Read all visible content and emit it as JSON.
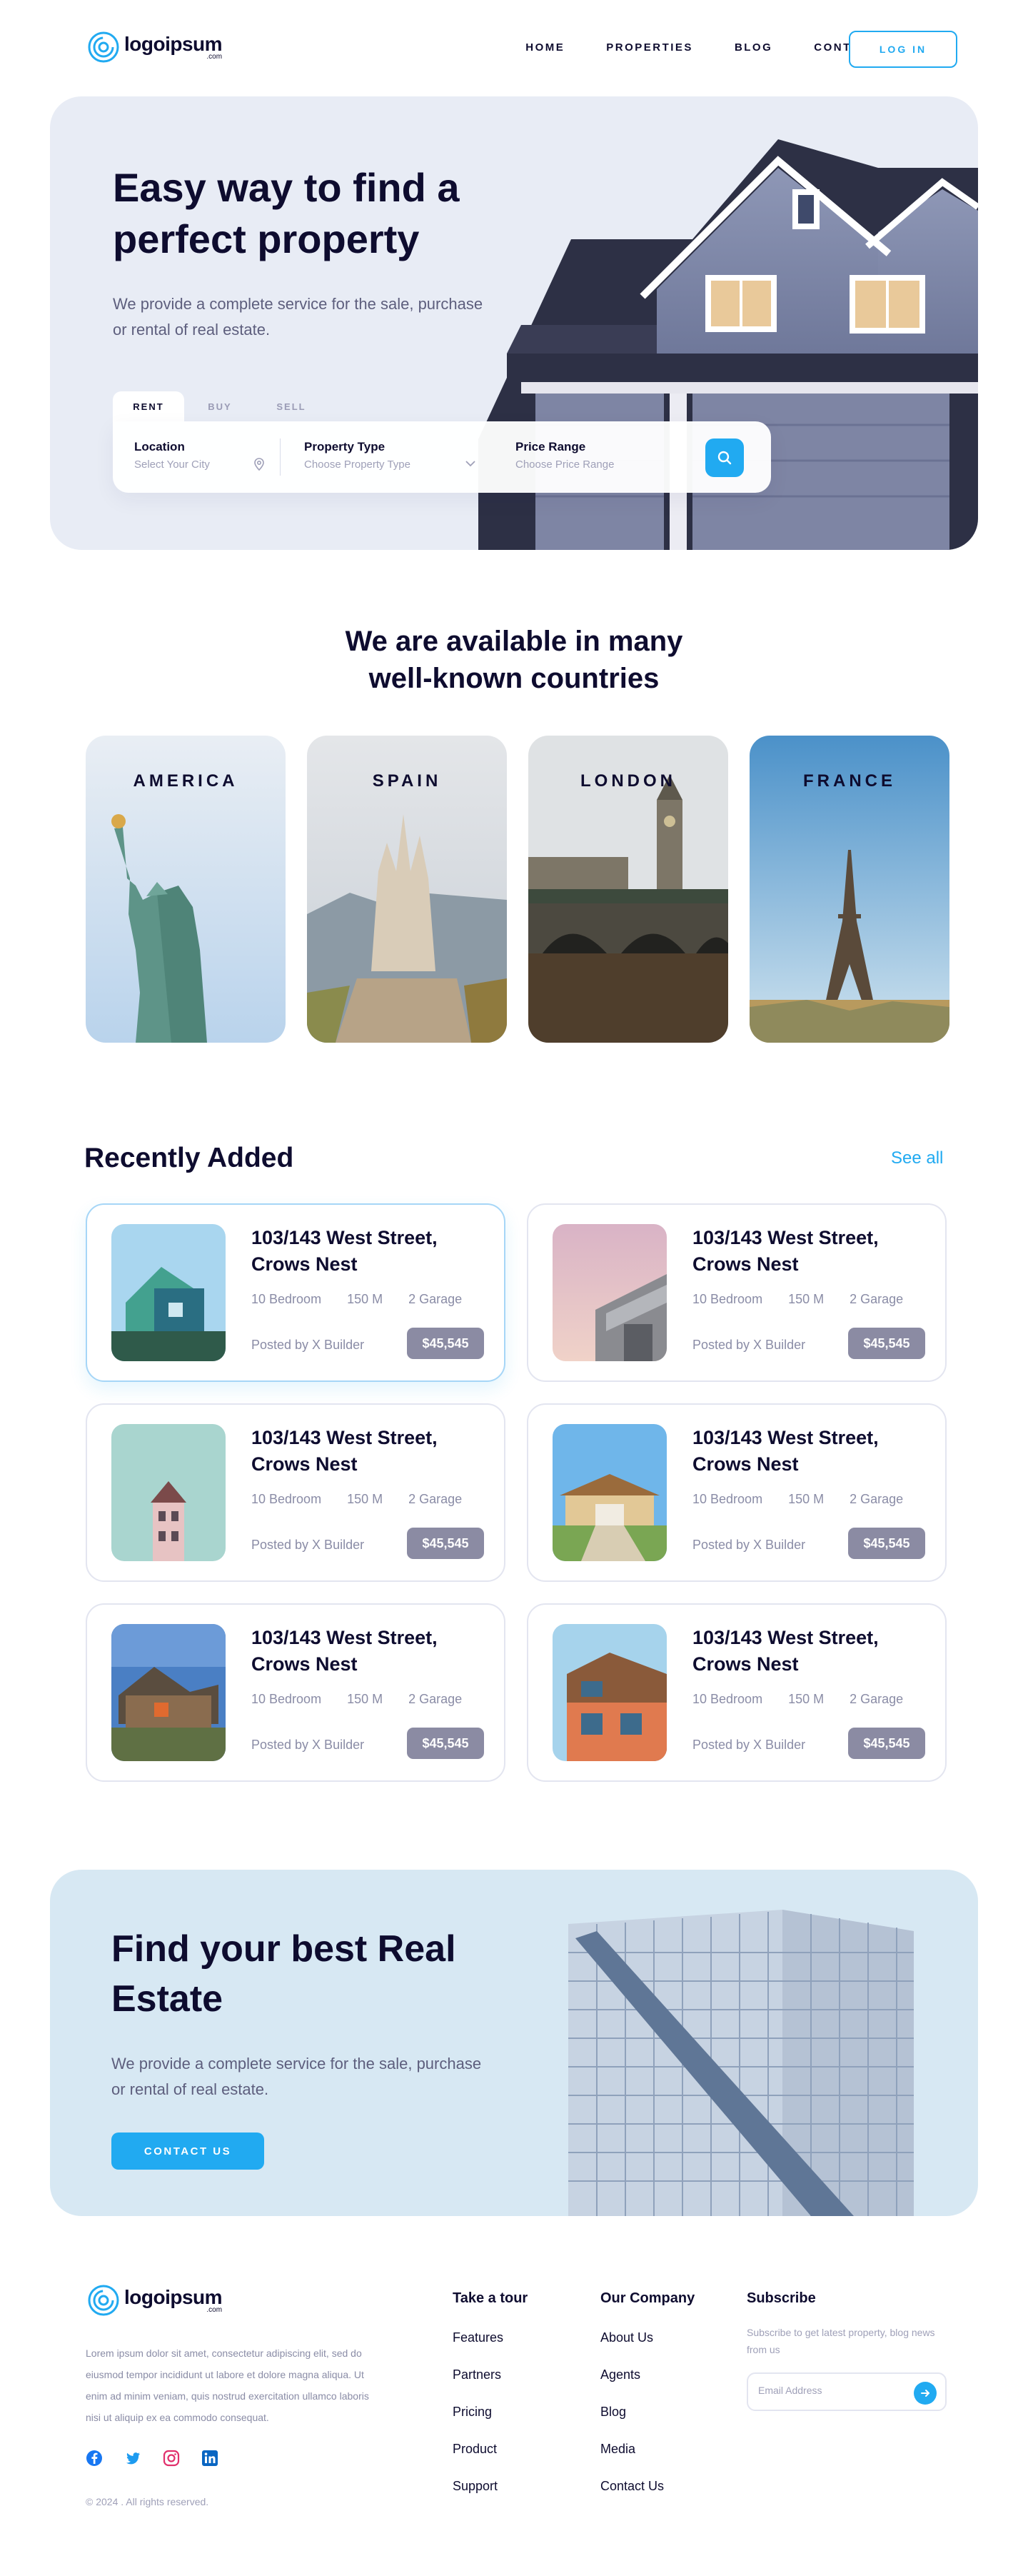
{
  "nav": {
    "logo_text": "logoipsum",
    "logo_suffix": ".com",
    "links": [
      "HOME",
      "PROPERTIES",
      "BLOG",
      "CONTACT"
    ],
    "login_label": "LOG IN"
  },
  "hero": {
    "title": "Easy way to find a perfect property",
    "subtitle": "We provide a complete service for the sale, purchase or rental of real estate.",
    "tabs": [
      "RENT",
      "BUY",
      "SELL"
    ],
    "active_tab": "RENT",
    "search": {
      "location_label": "Location",
      "location_placeholder": "Select Your City",
      "type_label": "Property Type",
      "type_placeholder": "Choose Property Type",
      "price_label": "Price Range",
      "price_placeholder": "Choose Price Range"
    }
  },
  "countries": {
    "title_line1": "We are available in many",
    "title_line2": "well-known countries",
    "items": [
      "AMERICA",
      "SPAIN",
      "LONDON",
      "FRANCE"
    ]
  },
  "recent": {
    "title": "Recently Added",
    "see_all": "See all",
    "cards": [
      {
        "title": "103/143 West Street, Crows Nest",
        "bedrooms": "10 Bedroom",
        "area": "150 M",
        "garage": "2 Garage",
        "posted": "Posted by X Builder",
        "price": "$45,545"
      },
      {
        "title": "103/143 West Street, Crows Nest",
        "bedrooms": "10 Bedroom",
        "area": "150 M",
        "garage": "2 Garage",
        "posted": "Posted by X Builder",
        "price": "$45,545"
      },
      {
        "title": "103/143 West Street, Crows Nest",
        "bedrooms": "10 Bedroom",
        "area": "150 M",
        "garage": "2 Garage",
        "posted": "Posted by X Builder",
        "price": "$45,545"
      },
      {
        "title": "103/143 West Street, Crows Nest",
        "bedrooms": "10 Bedroom",
        "area": "150 M",
        "garage": "2 Garage",
        "posted": "Posted by X Builder",
        "price": "$45,545"
      },
      {
        "title": "103/143 West Street, Crows Nest",
        "bedrooms": "10 Bedroom",
        "area": "150 M",
        "garage": "2 Garage",
        "posted": "Posted by X Builder",
        "price": "$45,545"
      },
      {
        "title": "103/143 West Street, Crows Nest",
        "bedrooms": "10 Bedroom",
        "area": "150 M",
        "garage": "2 Garage",
        "posted": "Posted by X Builder",
        "price": "$45,545"
      }
    ]
  },
  "cta": {
    "title": "Find your best Real Estate",
    "subtitle": "We provide a complete service for the sale, purchase or rental of real estate.",
    "button": "CONTACT US"
  },
  "footer": {
    "description": "Lorem ipsum dolor sit amet, consectetur adipiscing elit, sed do eiusmod tempor incididunt ut labore et dolore magna aliqua. Ut enim ad minim veniam, quis nostrud exercitation ullamco laboris nisi ut aliquip ex ea commodo consequat.",
    "copyright": "© 2024 . All rights reserved.",
    "col1": {
      "title": "Take a tour",
      "links": [
        "Features",
        "Partners",
        "Pricing",
        "Product",
        "Support"
      ]
    },
    "col2": {
      "title": "Our Company",
      "links": [
        "About Us",
        "Agents",
        "Blog",
        "Media",
        "Contact Us"
      ]
    },
    "subscribe": {
      "title": "Subscribe",
      "text": "Subscribe to get latest property, blog news from us",
      "placeholder": "Email Address"
    }
  },
  "colors": {
    "accent": "#21aaf1",
    "ink": "#0e0c2f",
    "muted": "#8a8ca6",
    "hero_bg": "#e8ecf5",
    "cta_bg": "#d7e8f3",
    "price_bg": "#8b8ba3"
  },
  "icons": [
    "logo-swirl-icon",
    "pin-icon",
    "chevron-down-icon",
    "search-icon",
    "facebook-icon",
    "twitter-icon",
    "instagram-icon",
    "linkedin-icon",
    "arrow-right-icon"
  ]
}
